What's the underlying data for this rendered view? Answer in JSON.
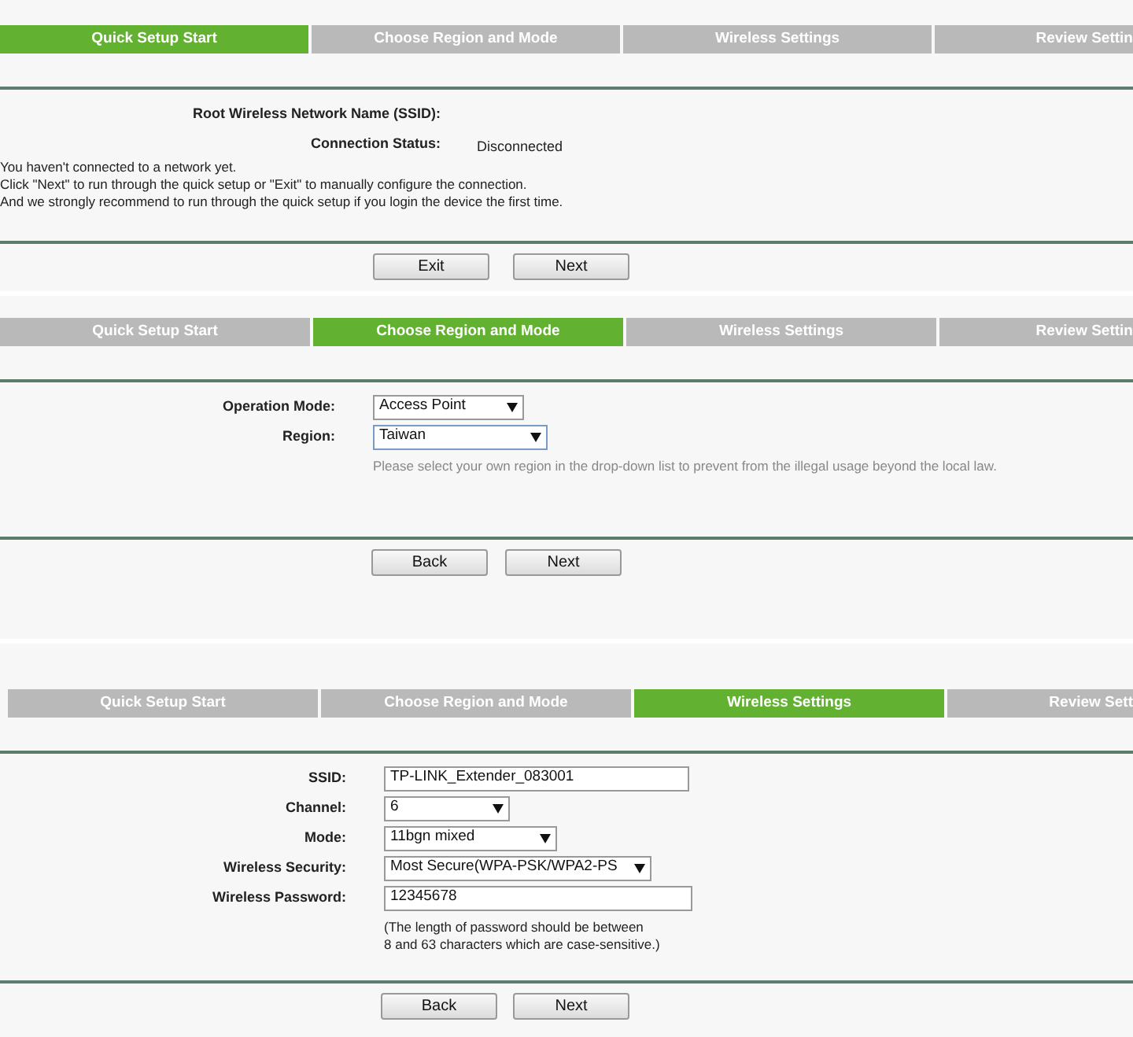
{
  "panels": [
    {
      "steps": [
        {
          "label": "Quick Setup Start",
          "selected": true
        },
        {
          "label": "Choose Region and Mode",
          "selected": false
        },
        {
          "label": "Wireless Settings",
          "selected": false
        },
        {
          "label": "Review Settin",
          "selected": false
        }
      ],
      "fields": [
        {
          "kind": "text",
          "label": "Root Wireless Network Name (SSID):"
        },
        {
          "kind": "text",
          "label": "Connection Status:",
          "value": "Disconnected"
        }
      ],
      "message": [
        "You haven't connected to a network yet.",
        "Click \"Next\" to run through the quick setup or \"Exit\" to manually configure the connection.",
        "And we strongly recommend to run through the quick setup if you login the device the first time."
      ],
      "buttons": [
        "Exit",
        "Next"
      ]
    },
    {
      "steps": [
        {
          "label": "Quick Setup Start",
          "selected": false
        },
        {
          "label": "Choose Region and Mode",
          "selected": true
        },
        {
          "label": "Wireless Settings",
          "selected": false
        },
        {
          "label": "Review Settin",
          "selected": false
        }
      ],
      "fields": [
        {
          "kind": "select",
          "label": "Operation Mode:",
          "value": "Access Point",
          "focused": false
        },
        {
          "kind": "select",
          "label": "Region:",
          "value": "Taiwan",
          "focused": true,
          "hint": [
            "Please select your own region in the drop-down list to prevent from the illegal usage beyond the local law."
          ]
        }
      ],
      "buttons": [
        "Back",
        "Next"
      ]
    },
    {
      "steps": [
        {
          "label": "Quick Setup Start",
          "selected": false
        },
        {
          "label": "Choose Region and Mode",
          "selected": false
        },
        {
          "label": "Wireless Settings",
          "selected": true
        },
        {
          "label": "Review Sett",
          "selected": false
        }
      ],
      "fields": [
        {
          "kind": "input",
          "label": "SSID:",
          "value": "TP-LINK_Extender_083001",
          "focused": false
        },
        {
          "kind": "select",
          "label": "Channel:",
          "value": "6",
          "focused": false
        },
        {
          "kind": "select",
          "label": "Mode:",
          "value": "11bgn mixed",
          "focused": false
        },
        {
          "kind": "select",
          "label": "Wireless Security:",
          "value": "Most Secure(WPA-PSK/WPA2-PS",
          "focused": false
        },
        {
          "kind": "input",
          "label": "Wireless Password:",
          "value": "12345678",
          "focused": false,
          "hint": [
            "(The length of password should be between",
            "8 and 63 characters which are case-sensitive.)"
          ]
        }
      ],
      "buttons": [
        "Back",
        "Next"
      ]
    }
  ]
}
